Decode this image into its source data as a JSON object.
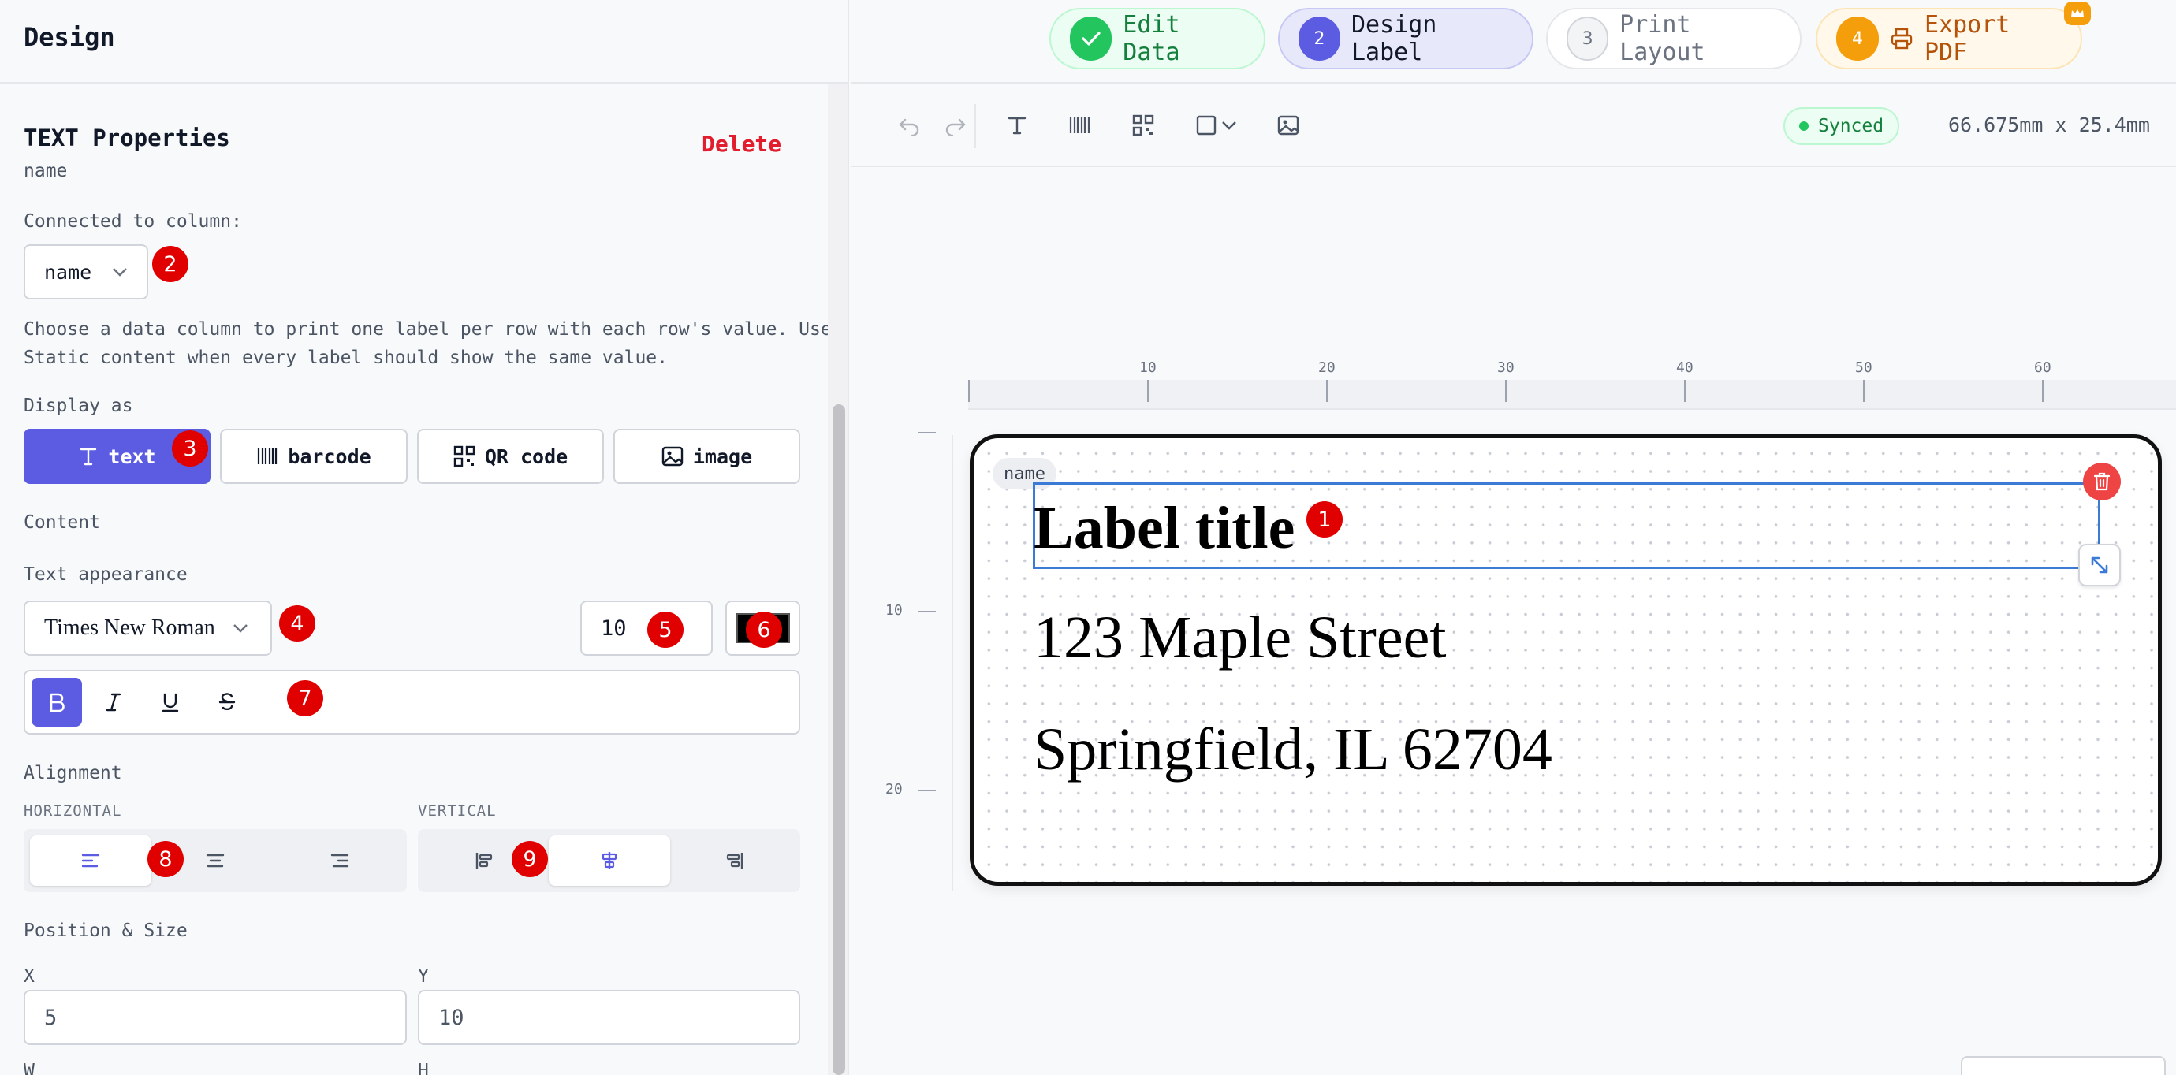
{
  "left_panel": {
    "title": "Design",
    "properties_title": "TEXT Properties",
    "element_name": "name",
    "delete_label": "Delete",
    "connected_label": "Connected to column:",
    "column_value": "name",
    "help_line1": "Choose a data column to print one label per row with each row's value. Use",
    "help_line2": "Static content when every label should show the same value.",
    "display_as_label": "Display as",
    "display_options": [
      "text",
      "barcode",
      "QR code",
      "image"
    ],
    "display_selected": "text",
    "content_label": "Content",
    "text_appearance_label": "Text appearance",
    "font_value": "Times New Roman",
    "font_size_value": "10",
    "color_value": "#000000",
    "alignment_label": "Alignment",
    "horizontal_label": "HORIZONTAL",
    "vertical_label": "VERTICAL",
    "position_size_label": "Position & Size",
    "x_label": "X",
    "y_label": "Y",
    "x_value": "5",
    "y_value": "10",
    "w_label": "W",
    "h_label": "H"
  },
  "steps": [
    {
      "num": "✓",
      "label": "Edit Data",
      "state": "done"
    },
    {
      "num": "2",
      "label": "Design Label",
      "state": "active"
    },
    {
      "num": "3",
      "label": "Print Layout",
      "state": "upcoming"
    },
    {
      "num": "4",
      "label": "Export PDF",
      "state": "premium"
    }
  ],
  "toolbar": {
    "synced_label": "Synced",
    "dimensions": "66.675mm x 25.4mm"
  },
  "ruler": {
    "top_ticks": [
      "10",
      "20",
      "30",
      "40",
      "50",
      "60"
    ],
    "left_ticks": [
      "10",
      "20"
    ]
  },
  "label_canvas": {
    "tag": "name",
    "line1": "Label title",
    "line2": "123 Maple Street",
    "line3": "Springfield, IL 62704"
  },
  "annotations": [
    "1",
    "2",
    "3",
    "4",
    "5",
    "6",
    "7",
    "8",
    "9"
  ],
  "colors": {
    "accent": "#5b5ce2",
    "danger": "#e11d2e",
    "success": "#22c55e",
    "premium": "#f59e0b",
    "selection": "#3b7bd6"
  }
}
